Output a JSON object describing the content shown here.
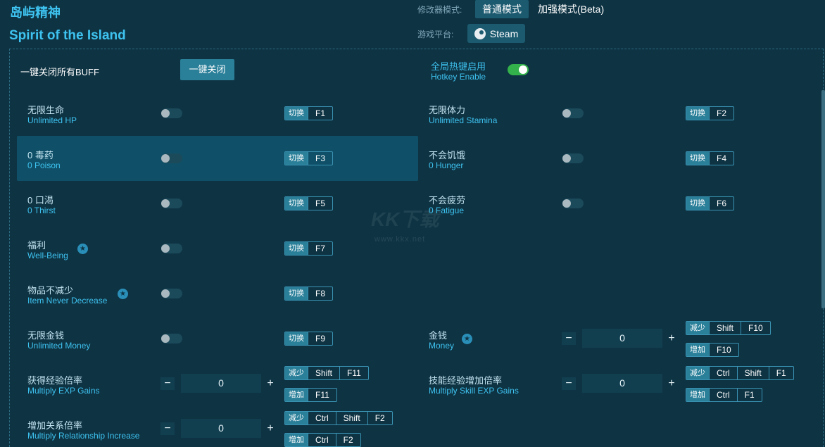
{
  "title_cn": "岛屿精神",
  "title_en": "Spirit of the Island",
  "mode_label": "修改器模式:",
  "mode_normal": "普通模式",
  "mode_enhanced": "加强模式(Beta)",
  "platform_label": "游戏平台:",
  "platform_name": "Steam",
  "close_all_label": "一键关闭所有BUFF",
  "close_all_button": "一键关闭",
  "hotkey_cn": "全局热键启用",
  "hotkey_en": "Hotkey Enable",
  "toggle_tag": "切换",
  "dec_tag": "减少",
  "inc_tag": "增加",
  "watermark": "KK下载",
  "watermark_url": "www.kkx.net",
  "options": [
    {
      "cn": "无限生命",
      "en": "Unlimited HP",
      "key": "F1"
    },
    {
      "cn": "无限体力",
      "en": "Unlimited Stamina",
      "key": "F2"
    },
    {
      "cn": "0 毒药",
      "en": "0 Poison",
      "key": "F3"
    },
    {
      "cn": "不会饥饿",
      "en": "0 Hunger",
      "key": "F4"
    },
    {
      "cn": "0 口渴",
      "en": "0 Thirst",
      "key": "F5"
    },
    {
      "cn": "不会疲劳",
      "en": "0 Fatigue",
      "key": "F6"
    },
    {
      "cn": "福利",
      "en": "Well-Being",
      "key": "F7"
    },
    {
      "cn": "物品不减少",
      "en": "Item Never Decrease",
      "key": "F8"
    },
    {
      "cn": "无限金钱",
      "en": "Unlimited Money",
      "key": "F9"
    }
  ],
  "money": {
    "cn": "金钱",
    "en": "Money",
    "value": "0",
    "dec_keys": [
      "Shift",
      "F10"
    ],
    "inc_keys": [
      "F10"
    ]
  },
  "exp": {
    "cn": "获得经验倍率",
    "en": "Multiply EXP Gains",
    "value": "0",
    "dec_keys": [
      "Shift",
      "F11"
    ],
    "inc_keys": [
      "F11"
    ]
  },
  "skill_exp": {
    "cn": "技能经验增加倍率",
    "en": "Multiply Skill EXP Gains",
    "value": "0",
    "dec_keys": [
      "Ctrl",
      "Shift",
      "F1"
    ],
    "inc_keys": [
      "Ctrl",
      "F1"
    ]
  },
  "relationship": {
    "cn": "增加关系倍率",
    "en": "Multiply Relationship Increase",
    "value": "0",
    "dec_keys": [
      "Ctrl",
      "Shift",
      "F2"
    ],
    "inc_keys": [
      "Ctrl",
      "F2"
    ]
  },
  "minus": "−",
  "plus": "+"
}
